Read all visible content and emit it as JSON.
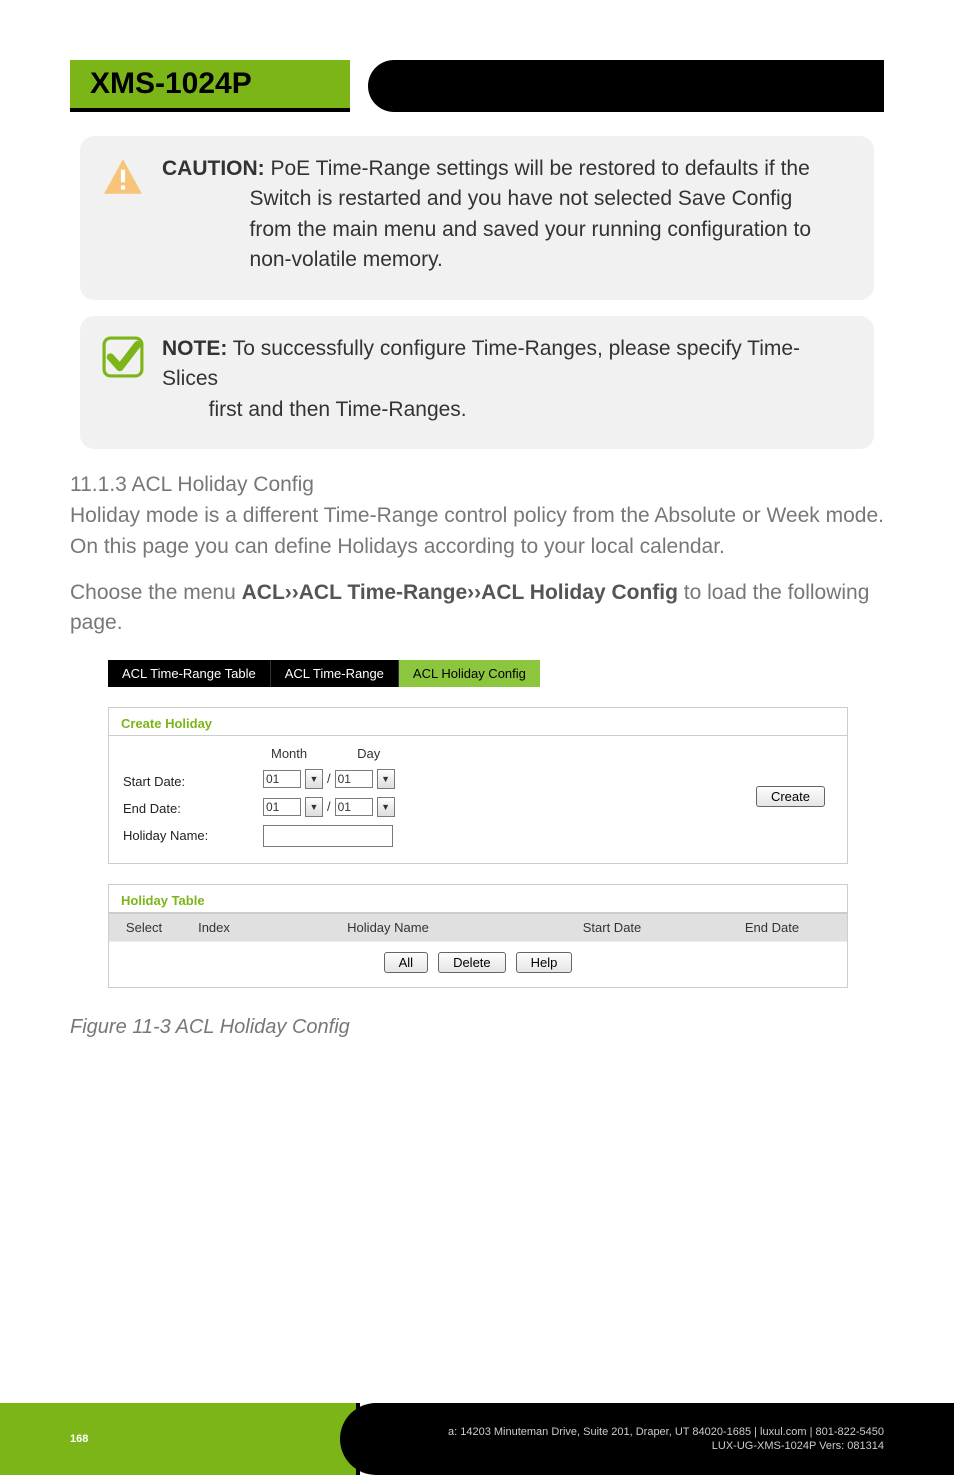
{
  "header": {
    "model": "XMS-1024P"
  },
  "callouts": {
    "caution_label": "CAUTION:",
    "caution_text": "PoE Time-Range settings will be restored to defaults if the Switch is restarted and you have not selected Save Config from the main menu and saved your running configuration to non-volatile memory.",
    "note_label": "NOTE:",
    "note_text": "To successfully configure Time-Ranges, please specify Time-Slices first and then Time-Ranges."
  },
  "section": {
    "number_title": "11.1.3 ACL Holiday Config",
    "intro": "Holiday mode is a different Time-Range control policy from the Absolute or Week mode. On this page you can define Holidays according to your local calendar.",
    "choose_prefix": "Choose the menu ",
    "menu_path": "ACL››ACL Time-Range››ACL Holiday Config",
    "choose_suffix": " to load the following page."
  },
  "config": {
    "tabs": [
      "ACL Time-Range Table",
      "ACL Time-Range",
      "ACL Holiday Config"
    ],
    "active_tab_index": 2,
    "create_card_title": "Create Holiday",
    "labels": {
      "month": "Month",
      "day": "Day",
      "start_date": "Start Date:",
      "end_date": "End Date:",
      "holiday_name": "Holiday Name:"
    },
    "values": {
      "start_month": "01",
      "start_day": "01",
      "end_month": "01",
      "end_day": "01",
      "holiday_name": ""
    },
    "buttons": {
      "create": "Create",
      "all": "All",
      "delete": "Delete",
      "help": "Help"
    },
    "holiday_table_title": "Holiday Table",
    "columns": {
      "select": "Select",
      "index": "Index",
      "holiday_name": "Holiday Name",
      "start_date": "Start Date",
      "end_date": "End Date"
    }
  },
  "figure_caption": "Figure 11-3 ACL Holiday Config",
  "footer": {
    "page_number": "168",
    "address": "a: 14203 Minuteman Drive, Suite 201, Draper, UT 84020-1685 | luxul.com | 801-822-5450",
    "docinfo": "LUX-UG-XMS-1024P  Vers: 081314"
  },
  "colors": {
    "accent_green": "#7cb518",
    "tab_green": "#8cc63e"
  }
}
